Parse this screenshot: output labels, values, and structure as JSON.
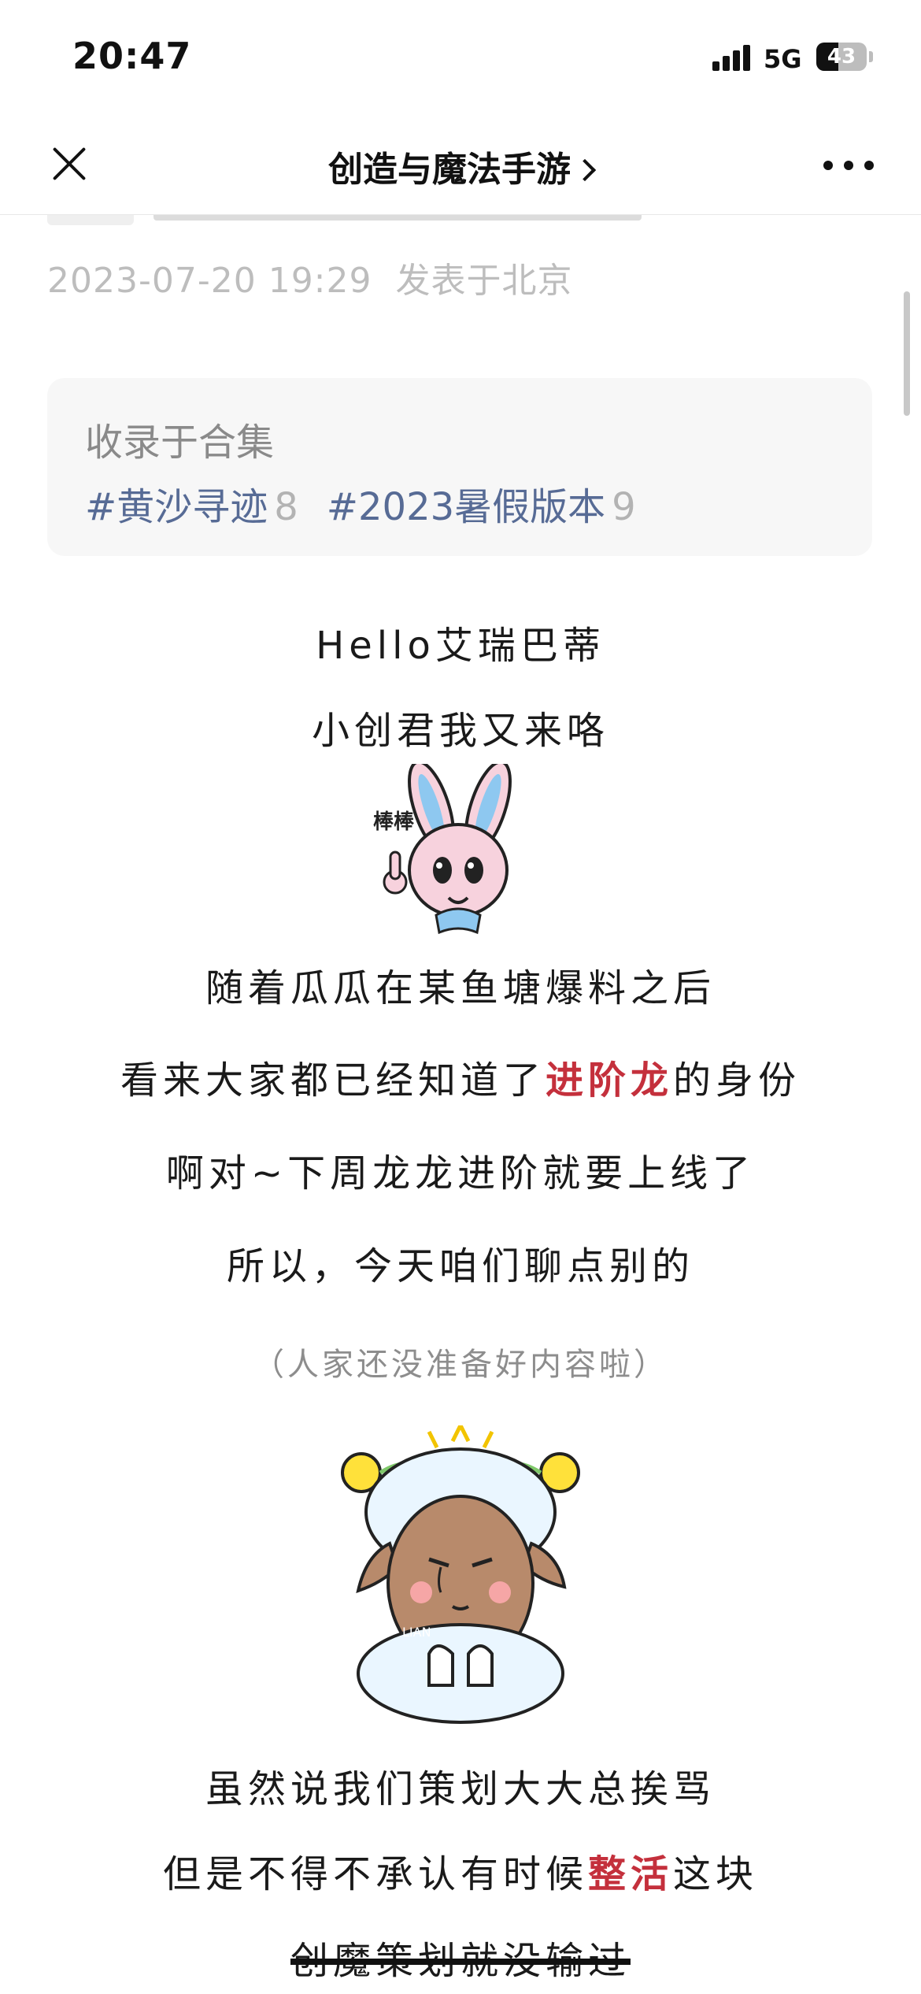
{
  "status_bar": {
    "time": "20:47",
    "network": "5G",
    "battery": "43",
    "battery_level_percent": 43,
    "signal_icon": "signal-bars-icon"
  },
  "nav": {
    "close_icon": "close-icon",
    "title": "创造与魔法手游",
    "title_icon": "chevron-right-icon",
    "more_icon": "more-horizontal-icon"
  },
  "article": {
    "date": "2023-07-20 19:29",
    "location": "发表于北京",
    "collection": {
      "label": "收录于合集",
      "tags": [
        {
          "name": "#黄沙寻迹",
          "count": "8"
        },
        {
          "name": "#2023暑假版本",
          "count": "9"
        }
      ]
    },
    "body": {
      "line1": "Hello艾瑞巴蒂",
      "line2": "小创君我又来咯",
      "bunny_sticker": {
        "text": "棒棒",
        "icon": "thumbs-up-bunny-sticker"
      },
      "line3": "随着瓜瓜在某鱼塘爆料之后",
      "line4": {
        "before": "看来大家都已经知道了",
        "highlight": "进阶龙",
        "after": "的身份"
      },
      "line5": "啊对~下周龙龙进阶就要上线了",
      "line6": "所以，今天咱们聊点别的",
      "note": "（人家还没准备好内容啦）",
      "sheep_sticker": {
        "text": "LIAN",
        "icon": "crying-sheep-sticker"
      },
      "line7": "虽然说我们策划大大总挨骂",
      "line8": {
        "before": "但是不得不承认有时候",
        "highlight": "整活",
        "after": "这块"
      },
      "line9": "创魔策划就没输过"
    },
    "colors": {
      "link": "#576b95",
      "highlight": "#c4303c",
      "meta": "#bdbdbd"
    }
  }
}
